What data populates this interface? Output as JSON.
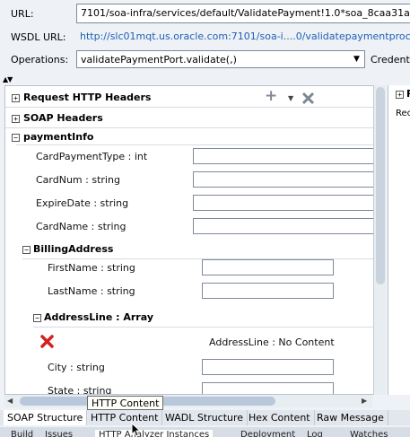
{
  "header": {
    "url_label": "URL:",
    "url_value": "7101/soa-infra/services/default/ValidatePayment!1.0*soa_8caa31aa",
    "wsdl_label": "WSDL URL:",
    "wsdl_value": "http://slc01mqt.us.oracle.com:7101/soa-i....0/validatepaymentproce",
    "operations_label": "Operations:",
    "operations_value": "validatePaymentPort.validate(,)",
    "credentials_label": "Credent"
  },
  "sections": {
    "request_headers": "Request HTTP Headers",
    "soap_headers": "SOAP Headers",
    "payment_info": "paymentInfo",
    "billing_address": "BillingAddress",
    "address_line": "AddressLine : Array"
  },
  "fields": {
    "card_payment_type": "CardPaymentType : int",
    "card_num": "CardNum : string",
    "expire_date": "ExpireDate : string",
    "card_name": "CardName : string",
    "first_name": "FirstName : string",
    "last_name": "LastName : string",
    "address_line_no_content": "AddressLine : No Content",
    "city": "City : string",
    "state": "State : string"
  },
  "right_panel": {
    "label_top": "R",
    "label_rec": "Rec"
  },
  "tooltip": "HTTP Content",
  "tabs": [
    "SOAP Structure",
    "HTTP Content",
    "WADL Structure",
    "Hex Content",
    "Raw Message"
  ],
  "dock": [
    "Build",
    "Issues",
    "HTTP Analyzer Instances",
    "Deployment",
    "Log",
    "Watches"
  ],
  "colors": {
    "link": "#1f5fb8",
    "delete_red": "#d42020"
  }
}
